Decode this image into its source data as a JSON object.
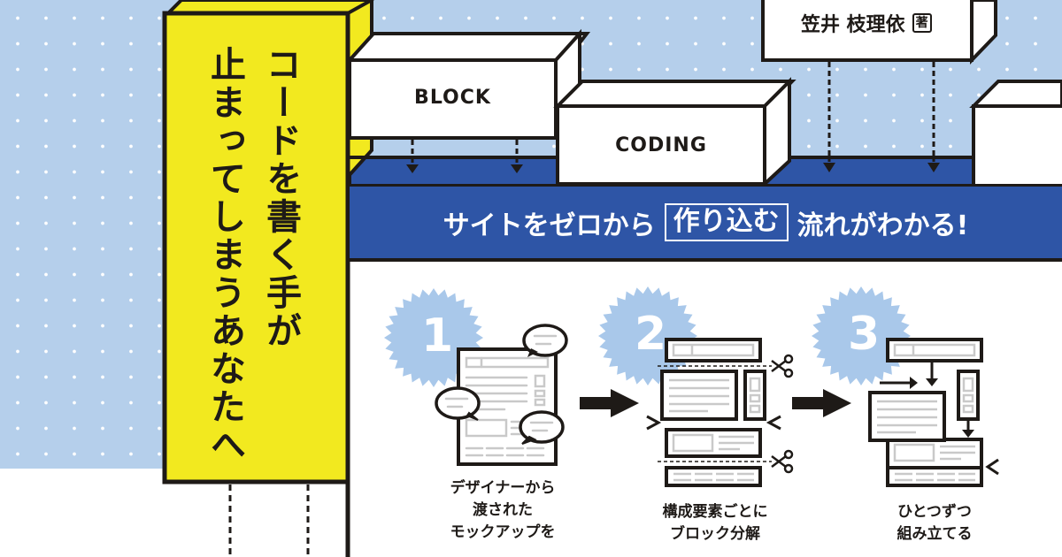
{
  "cover": {
    "vertical_title": {
      "line1": "コードを書く手が",
      "line2": "止まってしまうあなたへ"
    },
    "author": {
      "name": "笠井 枝理依",
      "role_tag": "著"
    },
    "blocks": {
      "block_label": "BLOCK",
      "coding_label": "CODING"
    },
    "banner": {
      "before": "サイトをゼロから",
      "highlight": "作り込む",
      "after": "流れがわかる!"
    },
    "steps": [
      {
        "number": "1",
        "caption_lines": [
          "デザイナーから",
          "渡された",
          "モックアップを"
        ],
        "illustration": "mockup-with-speech-bubbles"
      },
      {
        "number": "2",
        "caption_lines": [
          "構成要素ごとに",
          "ブロック分解"
        ],
        "illustration": "blocks-cut-with-scissors"
      },
      {
        "number": "3",
        "caption_lines": [
          "ひとつずつ",
          "組み立てる"
        ],
        "illustration": "blocks-assembled"
      }
    ],
    "icons": {
      "step_badge": "starburst-badge-icon",
      "flow_arrow": "right-arrow-icon",
      "scissors": "scissors-icon",
      "down_arrow": "down-arrow-icon",
      "sparkle": "sparkle-icon"
    },
    "colors": {
      "sky": "#b5cfeb",
      "yellow": "#f2e91f",
      "navy": "#2e55a6",
      "ink": "#1e1a17",
      "badge": "#a9c8ea",
      "line_gray": "#c9c9c9"
    }
  }
}
